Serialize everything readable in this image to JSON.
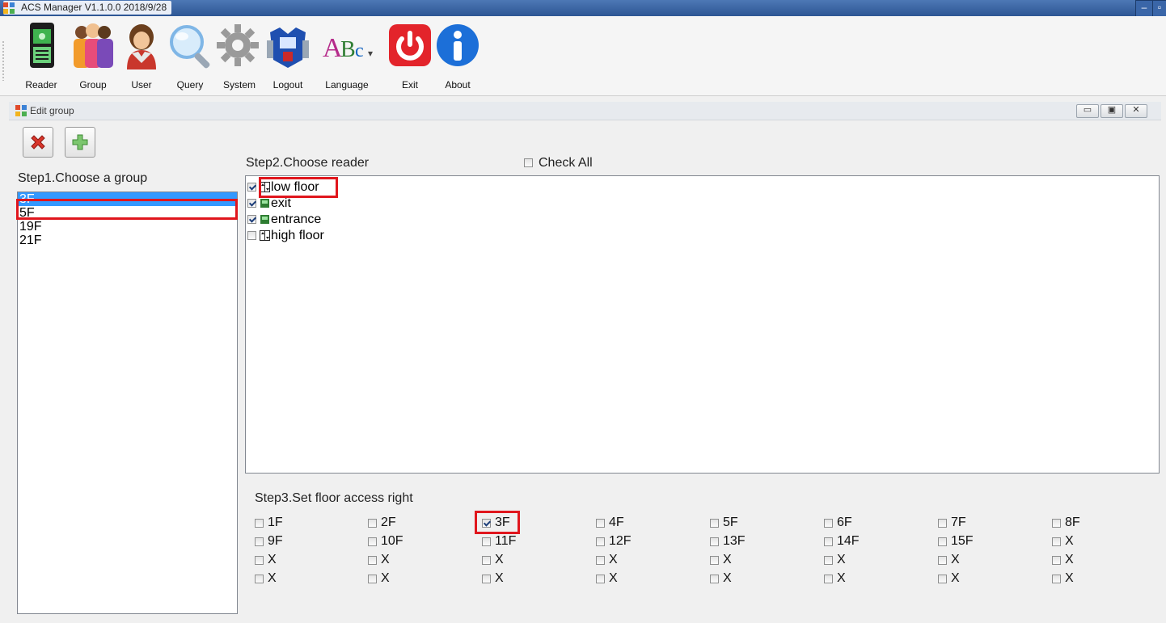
{
  "window": {
    "title": "ACS Manager V1.1.0.0 2018/9/28"
  },
  "toolbar": {
    "items": [
      {
        "label": "Reader",
        "icon": "reader-icon"
      },
      {
        "label": "Group",
        "icon": "group-icon"
      },
      {
        "label": "User",
        "icon": "user-icon"
      },
      {
        "label": "Query",
        "icon": "query-icon"
      },
      {
        "label": "System",
        "icon": "system-gear-icon"
      },
      {
        "label": "Logout",
        "icon": "logout-icon"
      },
      {
        "label": "Language",
        "icon": "language-icon"
      },
      {
        "label": "Exit",
        "icon": "exit-power-icon"
      },
      {
        "label": "About",
        "icon": "about-info-icon"
      }
    ]
  },
  "child_window": {
    "title": "Edit group"
  },
  "step1": {
    "label": "Step1.Choose a group",
    "groups": [
      "3F",
      "5F",
      "19F",
      "21F"
    ],
    "selected": "3F"
  },
  "step2": {
    "label": "Step2.Choose reader",
    "check_all": "Check All",
    "check_all_checked": false,
    "readers": [
      {
        "name": "low floor",
        "checked": true,
        "icon": "elevator-icon"
      },
      {
        "name": "exit",
        "checked": true,
        "icon": "door-reader-icon"
      },
      {
        "name": "entrance",
        "checked": true,
        "icon": "door-reader-icon"
      },
      {
        "name": "high floor",
        "checked": false,
        "icon": "elevator-icon"
      }
    ]
  },
  "step3": {
    "label": "Step3.Set floor access right",
    "floors": [
      {
        "label": "1F",
        "checked": false
      },
      {
        "label": "2F",
        "checked": false
      },
      {
        "label": "3F",
        "checked": true
      },
      {
        "label": "4F",
        "checked": false
      },
      {
        "label": "5F",
        "checked": false
      },
      {
        "label": "6F",
        "checked": false
      },
      {
        "label": "7F",
        "checked": false
      },
      {
        "label": "8F",
        "checked": false
      },
      {
        "label": "9F",
        "checked": false
      },
      {
        "label": "10F",
        "checked": false
      },
      {
        "label": "11F",
        "checked": false
      },
      {
        "label": "12F",
        "checked": false
      },
      {
        "label": "13F",
        "checked": false
      },
      {
        "label": "14F",
        "checked": false
      },
      {
        "label": "15F",
        "checked": false
      },
      {
        "label": "X",
        "checked": false
      },
      {
        "label": "X",
        "checked": false
      },
      {
        "label": "X",
        "checked": false
      },
      {
        "label": "X",
        "checked": false
      },
      {
        "label": "X",
        "checked": false
      },
      {
        "label": "X",
        "checked": false
      },
      {
        "label": "X",
        "checked": false
      },
      {
        "label": "X",
        "checked": false
      },
      {
        "label": "X",
        "checked": false
      },
      {
        "label": "X",
        "checked": false
      },
      {
        "label": "X",
        "checked": false
      },
      {
        "label": "X",
        "checked": false
      },
      {
        "label": "X",
        "checked": false
      },
      {
        "label": "X",
        "checked": false
      },
      {
        "label": "X",
        "checked": false
      },
      {
        "label": "X",
        "checked": false
      },
      {
        "label": "X",
        "checked": false
      }
    ]
  },
  "colors": {
    "selection": "#3399ff",
    "highlight_box": "#e0161d",
    "titlebar": "#2d5694"
  }
}
